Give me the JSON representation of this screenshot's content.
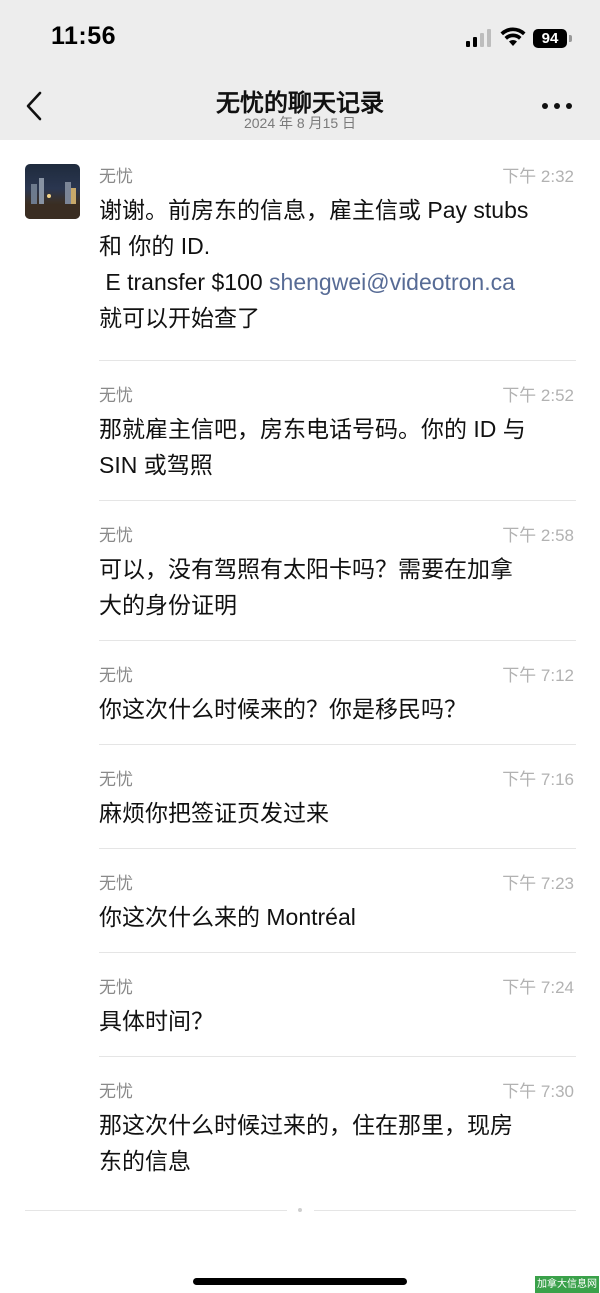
{
  "status_bar": {
    "time": "11:56",
    "battery": "94"
  },
  "nav": {
    "title": "无忧的聊天记录",
    "subtitle": "2024 年 8 月15 日"
  },
  "messages": [
    {
      "sender": "无忧",
      "time": "下午 2:32",
      "line1": "谢谢。前房东的信息，雇主信或 Pay stubs",
      "line2": "和 你的 ID.",
      "line3_prefix": " E transfer $100 ",
      "line3_link": "shengwei@videotron.ca",
      "line4": "就可以开始查了"
    },
    {
      "sender": "无忧",
      "time": "下午 2:52",
      "line1": "那就雇主信吧，房东电话号码。你的 ID 与",
      "line2": "SIN 或驾照"
    },
    {
      "sender": "无忧",
      "time": "下午 2:58",
      "line1": "可以，没有驾照有太阳卡吗？需要在加拿",
      "line2": "大的身份证明"
    },
    {
      "sender": "无忧",
      "time": "下午 7:12",
      "line1": "你这次什么时候来的？你是移民吗？"
    },
    {
      "sender": "无忧",
      "time": "下午 7:16",
      "line1": "麻烦你把签证页发过来"
    },
    {
      "sender": "无忧",
      "time": "下午 7:23",
      "line1": "你这次什么来的 Montréal"
    },
    {
      "sender": "无忧",
      "time": "下午 7:24",
      "line1": "具体时间？"
    },
    {
      "sender": "无忧",
      "time": "下午 7:30",
      "line1": "那这次什么时候过来的，住在那里，现房",
      "line2": "东的信息"
    }
  ],
  "watermark": "加拿大信息网",
  "colors": {
    "header_bg": "#ededed",
    "link": "#576b95",
    "watermark_bg": "#3aa14a"
  }
}
